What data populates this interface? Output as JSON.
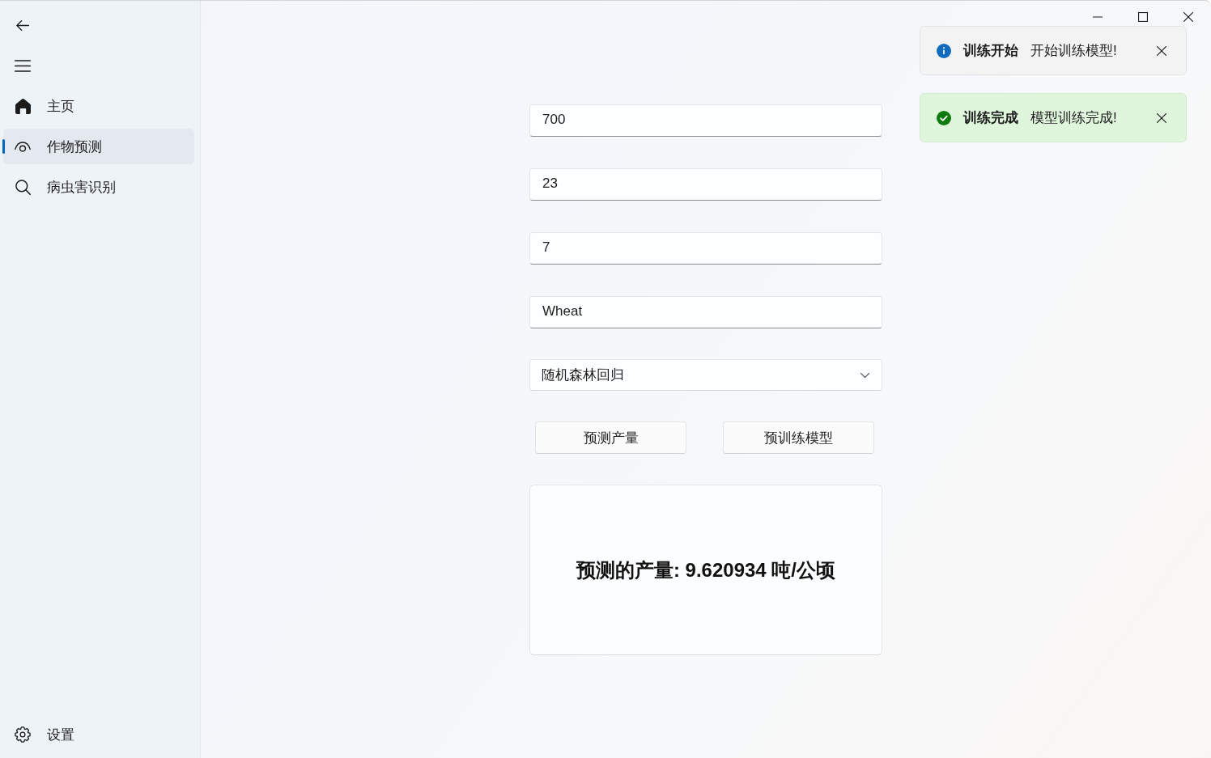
{
  "sidebar": {
    "items": [
      {
        "label": "主页",
        "selected": false
      },
      {
        "label": "作物预测",
        "selected": true
      },
      {
        "label": "病虫害识别",
        "selected": false
      }
    ],
    "footer_items": [
      {
        "label": "设置",
        "selected": false
      }
    ]
  },
  "form": {
    "fields": [
      {
        "value": "700"
      },
      {
        "value": "23"
      },
      {
        "value": "7"
      },
      {
        "value": "Wheat"
      }
    ],
    "model_select": {
      "value": "随机森林回归"
    },
    "buttons": [
      "预测产量",
      "预训练模型"
    ],
    "result": "预测的产量: 9.620934 吨/公顷"
  },
  "notifications": [
    {
      "kind": "info",
      "title": "训练开始",
      "message": "开始训练模型!"
    },
    {
      "kind": "success",
      "title": "训练完成",
      "message": "模型训练完成!"
    }
  ]
}
